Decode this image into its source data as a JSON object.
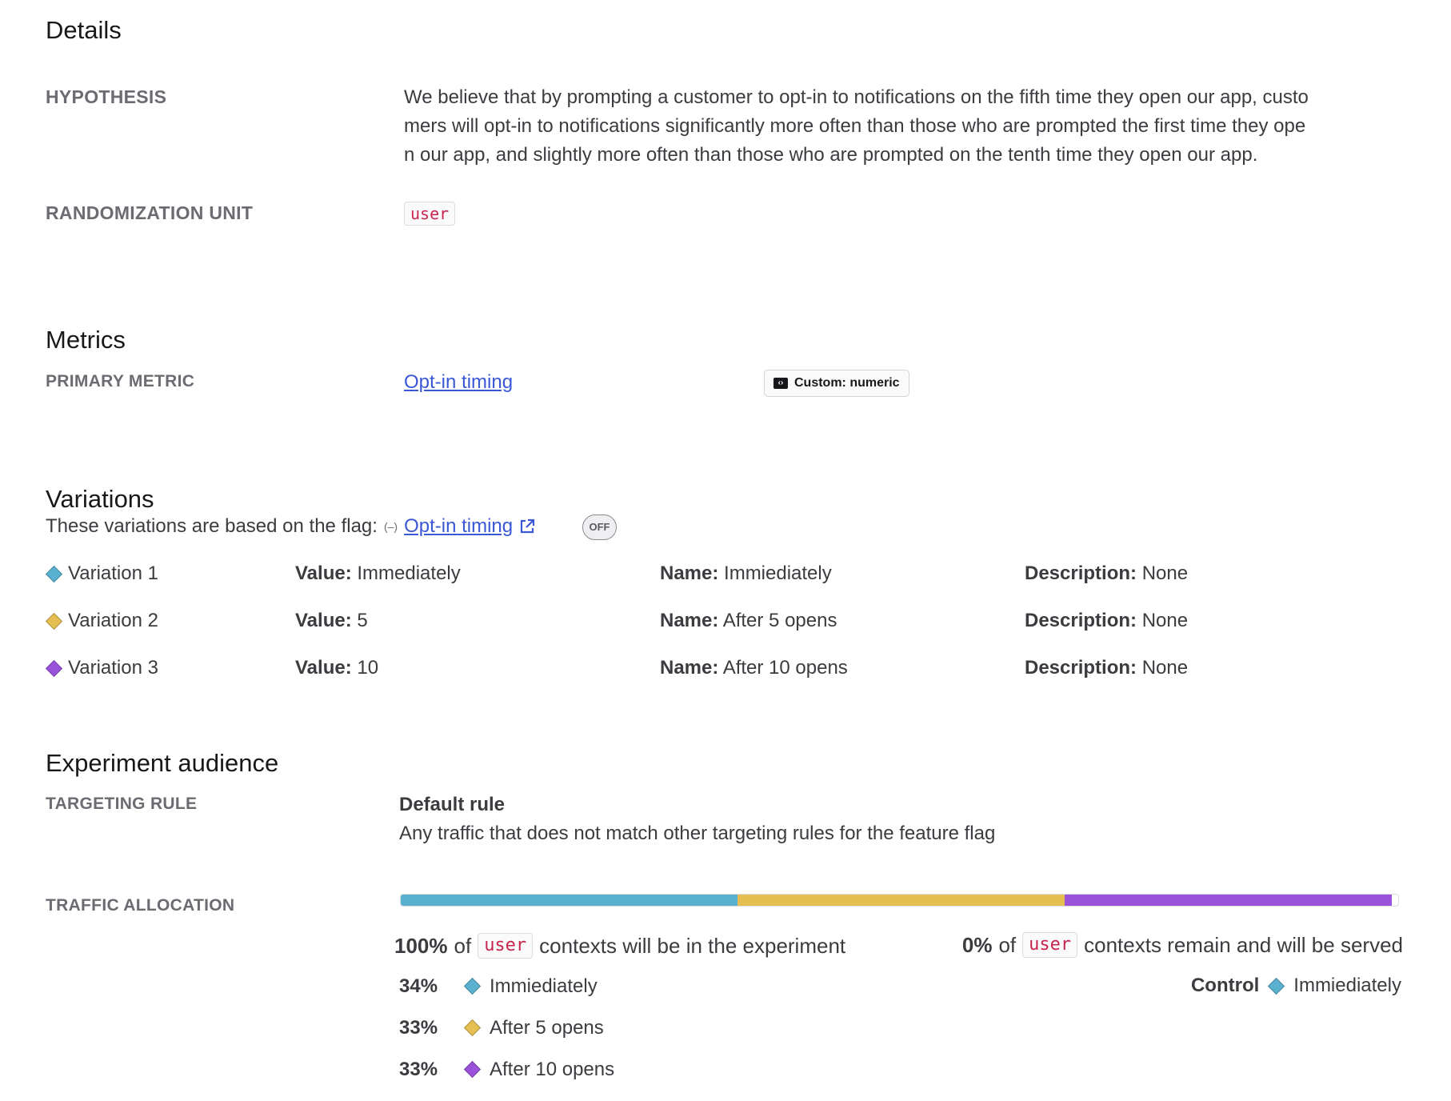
{
  "details": {
    "title": "Details",
    "hypothesis_label": "HYPOTHESIS",
    "hypothesis_lines": [
      "We believe that by prompting a customer to opt-in to notifications on the fifth time they open our app, custo",
      "mers will opt-in to notifications significantly more often than those who are prompted the first time they ope",
      "n our app, and slightly more often than those who are prompted on the tenth time they open our app."
    ],
    "randomization_label": "RANDOMIZATION UNIT",
    "randomization_value": "user"
  },
  "metrics": {
    "title": "Metrics",
    "primary_label": "PRIMARY METRIC",
    "primary_link": "Opt-in timing",
    "primary_tag": "Custom: numeric",
    "tag_icon": "code-icon"
  },
  "variations": {
    "title": "Variations",
    "subtitle": "These variations are based on the flag:",
    "flag_icon": "toggle-icon",
    "flag_name": "Opt-in timing",
    "flag_link_icon": "external-link-icon",
    "flag_status": "OFF",
    "value_key": "Value:",
    "name_key": "Name:",
    "description_key": "Description:",
    "items": [
      {
        "label": "Variation 1",
        "value": "Immediately",
        "name": "Immiediately",
        "description": "None",
        "color": "#5ab1cf"
      },
      {
        "label": "Variation 2",
        "value": "5",
        "name": "After 5 opens",
        "description": "None",
        "color": "#e6bf52"
      },
      {
        "label": "Variation 3",
        "value": "10",
        "name": "After 10 opens",
        "description": "None",
        "color": "#9b52da"
      }
    ]
  },
  "audience": {
    "title": "Experiment audience",
    "targeting_label": "TARGETING RULE",
    "rule_title": "Default rule",
    "rule_desc": "Any traffic that does not match other targeting rules for the feature flag",
    "traffic_label": "TRAFFIC ALLOCATION",
    "in_percent": "100%",
    "of_word": "of",
    "unit": "user",
    "in_text": "contexts will be in the experiment",
    "out_percent": "0%",
    "out_text": "contexts remain and will be served",
    "control_label": "Control",
    "control_name": "Immiediately",
    "control_color": "#5ab1cf",
    "allocations": [
      {
        "percent": "34%",
        "name": "Immiediately",
        "color": "#5ab1cf",
        "fraction": 0.34
      },
      {
        "percent": "33%",
        "name": "After 5 opens",
        "color": "#e6bf52",
        "fraction": 0.33
      },
      {
        "percent": "33%",
        "name": "After 10 opens",
        "color": "#9b52da",
        "fraction": 0.33
      }
    ]
  }
}
